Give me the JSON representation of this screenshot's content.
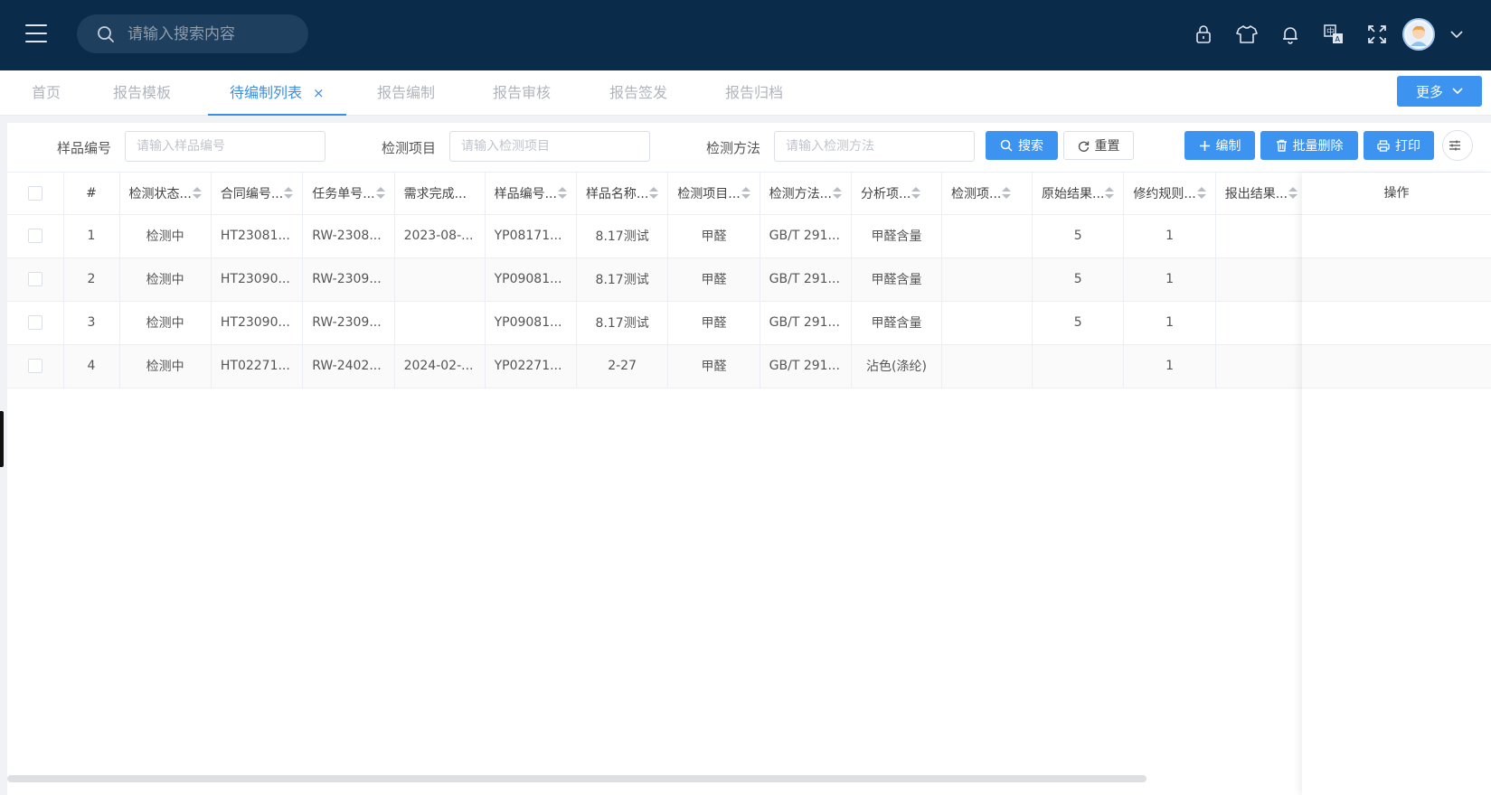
{
  "header": {
    "search_placeholder": "请输入搜索内容",
    "icons": [
      "lock-icon",
      "shirt-icon",
      "bell-icon",
      "translate-icon",
      "fullscreen-icon"
    ],
    "bg_color": "#0b2b4b"
  },
  "tabs": {
    "items": [
      {
        "label": "首页",
        "active": false
      },
      {
        "label": "报告模板",
        "active": false
      },
      {
        "label": "待编制列表",
        "active": true
      },
      {
        "label": "报告编制",
        "active": false
      },
      {
        "label": "报告审核",
        "active": false
      },
      {
        "label": "报告签发",
        "active": false
      },
      {
        "label": "报告归档",
        "active": false
      }
    ],
    "close_label": "×",
    "more_label": "更多"
  },
  "filters": {
    "sample_no_label": "样品编号",
    "sample_no_placeholder": "请输入样品编号",
    "item_label": "检测项目",
    "item_placeholder": "请输入检测项目",
    "method_label": "检测方法",
    "method_placeholder": "请输入检测方法",
    "search_label": "搜索",
    "reset_label": "重置",
    "edit_label": "编制",
    "batch_delete_label": "批量删除",
    "print_label": "打印"
  },
  "table": {
    "headers": [
      "#",
      "检测状态...",
      "合同编号...",
      "任务单号...",
      "需求完成...",
      "样品编号...",
      "样品名称...",
      "检测项目...",
      "检测方法...",
      "分析项...",
      "检测项...",
      "原始结果...",
      "修约规则...",
      "报出结果..."
    ],
    "op_header": "操作",
    "rows": [
      [
        "1",
        "检测中",
        "HT23081...",
        "RW-2308...",
        "2023-08-...",
        "YP08171...",
        "8.17测试",
        "甲醛",
        "GB/T 291...",
        "甲醛含量",
        "",
        "5",
        "1",
        ""
      ],
      [
        "2",
        "检测中",
        "HT23090...",
        "RW-2309...",
        "",
        "YP09081...",
        "8.17测试",
        "甲醛",
        "GB/T 291...",
        "甲醛含量",
        "",
        "5",
        "1",
        ""
      ],
      [
        "3",
        "检测中",
        "HT23090...",
        "RW-2309...",
        "",
        "YP09081...",
        "8.17测试",
        "甲醛",
        "GB/T 291...",
        "甲醛含量",
        "",
        "5",
        "1",
        ""
      ],
      [
        "4",
        "检测中",
        "HT02271...",
        "RW-2402...",
        "2024-02-...",
        "YP02271...",
        "2-27",
        "甲醛",
        "GB/T 291...",
        "沾色(涤纶)",
        "",
        "",
        "1",
        ""
      ]
    ]
  },
  "accent_color": "#3c94f0"
}
